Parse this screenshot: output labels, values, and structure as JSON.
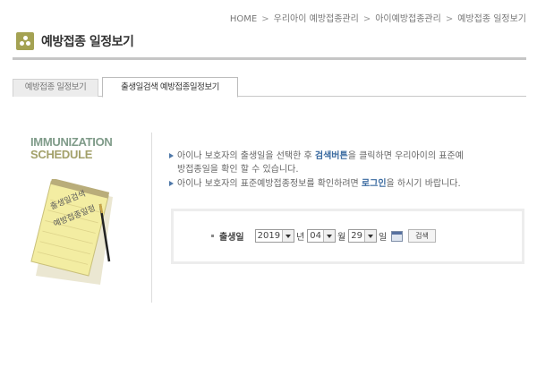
{
  "breadcrumb": {
    "items": [
      "HOME",
      "우리아이 예방접종관리",
      "아이예방접종관리",
      "예방접종 일정보기"
    ],
    "separator": ">"
  },
  "page": {
    "title": "예방접종 일정보기",
    "accent_color": "#a4a253"
  },
  "tabs": [
    {
      "label": "예방접종 일정보기",
      "active": false
    },
    {
      "label": "출생일검색 예방접종일정보기",
      "active": true
    }
  ],
  "banner": {
    "title_line1": "IMMUNIZATION",
    "title_line2": "SCHEDULE",
    "note_text_line1": "출생일검색",
    "note_text_line2": "예방접종일정"
  },
  "info": {
    "line1_pre": "아이나 보호자의 출생일을 선택한 후 ",
    "line1_em": "검색버튼",
    "line1_post": "을 클릭하면 우리아이의 표준예",
    "line1_cont": "방접종일을 확인 할 수 있습니다.",
    "line2_pre": "아이나 보호자의 표준예방접종정보를 확인하려면 ",
    "line2_em": "로그인",
    "line2_post": "을 하시기 바랍니다."
  },
  "search": {
    "label": "출생일",
    "year_value": "2019",
    "year_unit": "년",
    "month_value": "04",
    "month_unit": "월",
    "day_value": "29",
    "day_unit": "일",
    "button_label": "검색"
  }
}
